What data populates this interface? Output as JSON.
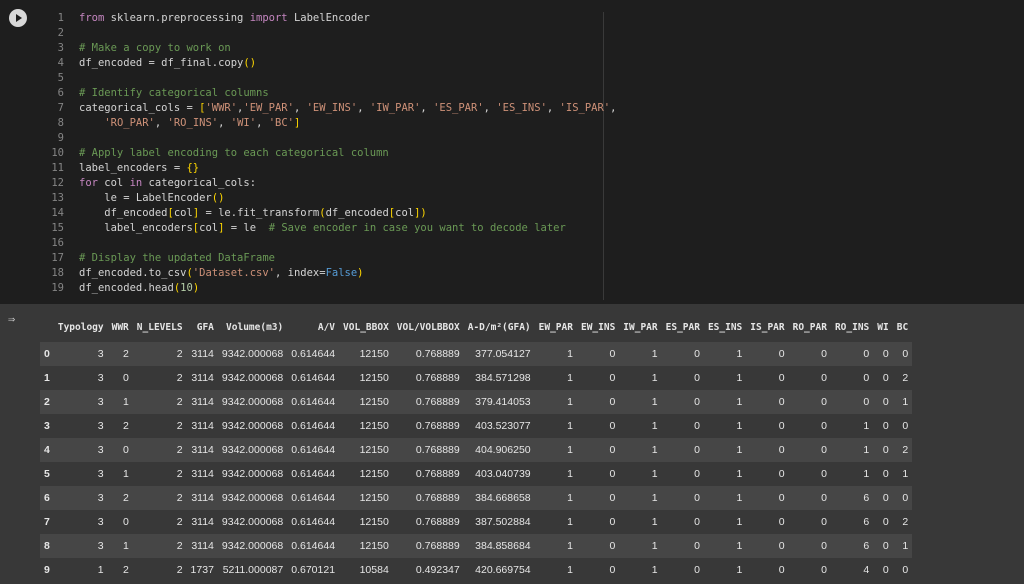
{
  "code_lines": [
    {
      "n": "1",
      "html": "<span class=\"kw\">from</span> sklearn.preprocessing <span class=\"kw\">import</span> LabelEncoder"
    },
    {
      "n": "2",
      "html": ""
    },
    {
      "n": "3",
      "html": "<span class=\"cm\"># Make a copy to work on</span>"
    },
    {
      "n": "4",
      "html": "df_encoded = df_final.copy<span class=\"br\">()</span>"
    },
    {
      "n": "5",
      "html": ""
    },
    {
      "n": "6",
      "html": "<span class=\"cm\"># Identify categorical columns</span>"
    },
    {
      "n": "7",
      "html": "categorical_cols = <span class=\"br\">[</span><span class=\"str\">'WWR'</span>,<span class=\"str\">'EW_PAR'</span>, <span class=\"str\">'EW_INS'</span>, <span class=\"str\">'IW_PAR'</span>, <span class=\"str\">'ES_PAR'</span>, <span class=\"str\">'ES_INS'</span>, <span class=\"str\">'IS_PAR'</span>,"
    },
    {
      "n": "8",
      "html": "    <span class=\"str\">'RO_PAR'</span>, <span class=\"str\">'RO_INS'</span>, <span class=\"str\">'WI'</span>, <span class=\"str\">'BC'</span><span class=\"br\">]</span>"
    },
    {
      "n": "9",
      "html": ""
    },
    {
      "n": "10",
      "html": "<span class=\"cm\"># Apply label encoding to each categorical column</span>"
    },
    {
      "n": "11",
      "html": "label_encoders = <span class=\"br\">{}</span>"
    },
    {
      "n": "12",
      "html": "<span class=\"kw\">for</span> col <span class=\"kw\">in</span> categorical_cols:"
    },
    {
      "n": "13",
      "html": "    le = LabelEncoder<span class=\"br\">()</span>"
    },
    {
      "n": "14",
      "html": "    df_encoded<span class=\"br\">[</span>col<span class=\"br\">]</span> = le.fit_transform<span class=\"br\">(</span>df_encoded<span class=\"br\">[</span>col<span class=\"br\">]</span><span class=\"br\">)</span>"
    },
    {
      "n": "15",
      "html": "    label_encoders<span class=\"br\">[</span>col<span class=\"br\">]</span> = le  <span class=\"cm\"># Save encoder in case you want to decode later</span>"
    },
    {
      "n": "16",
      "html": ""
    },
    {
      "n": "17",
      "html": "<span class=\"cm\"># Display the updated DataFrame</span>"
    },
    {
      "n": "18",
      "html": "df_encoded.to_csv<span class=\"br\">(</span><span class=\"str\">'Dataset.csv'</span>, index=<span class=\"bl\">False</span><span class=\"br\">)</span>"
    },
    {
      "n": "19",
      "html": "df_encoded.head<span class=\"br\">(</span><span class=\"nm\">10</span><span class=\"br\">)</span>"
    }
  ],
  "table": {
    "headers": [
      "",
      "Typology",
      "WWR",
      "N_LEVELS",
      "GFA",
      "Volume(m3)",
      "A/V",
      "VOL_BBOX",
      "VOL/VOLBBOX",
      "A-D/m²(GFA)",
      "EW_PAR",
      "EW_INS",
      "IW_PAR",
      "ES_PAR",
      "ES_INS",
      "IS_PAR",
      "RO_PAR",
      "RO_INS",
      "WI",
      "BC"
    ],
    "rows": [
      [
        "0",
        "3",
        "2",
        "2",
        "3114",
        "9342.000068",
        "0.614644",
        "12150",
        "0.768889",
        "377.054127",
        "1",
        "0",
        "1",
        "0",
        "1",
        "0",
        "0",
        "0",
        "0",
        "0"
      ],
      [
        "1",
        "3",
        "0",
        "2",
        "3114",
        "9342.000068",
        "0.614644",
        "12150",
        "0.768889",
        "384.571298",
        "1",
        "0",
        "1",
        "0",
        "1",
        "0",
        "0",
        "0",
        "0",
        "2"
      ],
      [
        "2",
        "3",
        "1",
        "2",
        "3114",
        "9342.000068",
        "0.614644",
        "12150",
        "0.768889",
        "379.414053",
        "1",
        "0",
        "1",
        "0",
        "1",
        "0",
        "0",
        "0",
        "0",
        "1"
      ],
      [
        "3",
        "3",
        "2",
        "2",
        "3114",
        "9342.000068",
        "0.614644",
        "12150",
        "0.768889",
        "403.523077",
        "1",
        "0",
        "1",
        "0",
        "1",
        "0",
        "0",
        "1",
        "0",
        "0"
      ],
      [
        "4",
        "3",
        "0",
        "2",
        "3114",
        "9342.000068",
        "0.614644",
        "12150",
        "0.768889",
        "404.906250",
        "1",
        "0",
        "1",
        "0",
        "1",
        "0",
        "0",
        "1",
        "0",
        "2"
      ],
      [
        "5",
        "3",
        "1",
        "2",
        "3114",
        "9342.000068",
        "0.614644",
        "12150",
        "0.768889",
        "403.040739",
        "1",
        "0",
        "1",
        "0",
        "1",
        "0",
        "0",
        "1",
        "0",
        "1"
      ],
      [
        "6",
        "3",
        "2",
        "2",
        "3114",
        "9342.000068",
        "0.614644",
        "12150",
        "0.768889",
        "384.668658",
        "1",
        "0",
        "1",
        "0",
        "1",
        "0",
        "0",
        "6",
        "0",
        "0"
      ],
      [
        "7",
        "3",
        "0",
        "2",
        "3114",
        "9342.000068",
        "0.614644",
        "12150",
        "0.768889",
        "387.502884",
        "1",
        "0",
        "1",
        "0",
        "1",
        "0",
        "0",
        "6",
        "0",
        "2"
      ],
      [
        "8",
        "3",
        "1",
        "2",
        "3114",
        "9342.000068",
        "0.614644",
        "12150",
        "0.768889",
        "384.858684",
        "1",
        "0",
        "1",
        "0",
        "1",
        "0",
        "0",
        "6",
        "0",
        "1"
      ],
      [
        "9",
        "1",
        "2",
        "2",
        "1737",
        "5211.000087",
        "0.670121",
        "10584",
        "0.492347",
        "420.669754",
        "1",
        "0",
        "1",
        "0",
        "1",
        "0",
        "0",
        "4",
        "0",
        "0"
      ]
    ]
  },
  "icons": {
    "run": "run-cell-icon",
    "output": "output-toggle-icon"
  }
}
